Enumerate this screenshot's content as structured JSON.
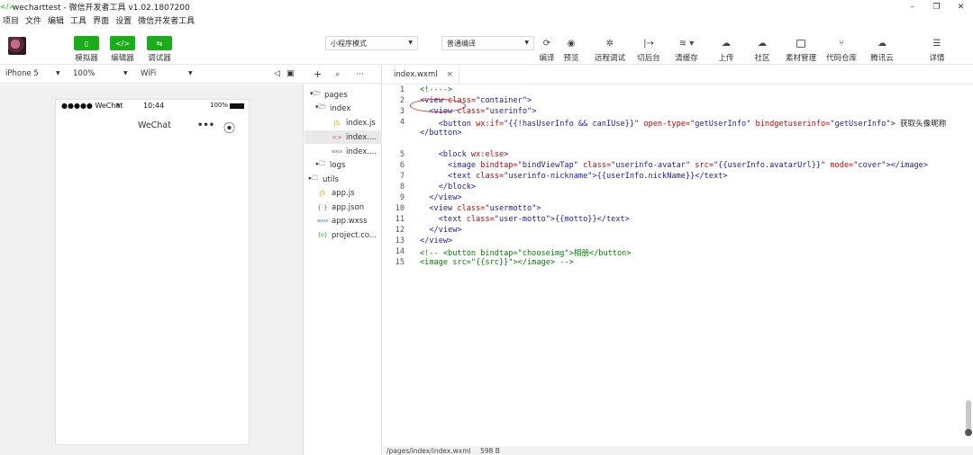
{
  "window": {
    "title": "wecharttest - 微信开发者工具 v1.02.1807200",
    "minimize": "–",
    "maximize": "❐",
    "close": "✕"
  },
  "menu": [
    "项目",
    "文件",
    "编辑",
    "工具",
    "界面",
    "设置",
    "微信开发者工具"
  ],
  "toolbar": {
    "simulator": "模拟器",
    "editor": "编辑器",
    "debugger": "调试器",
    "mode_select": "小程序模式",
    "compile_select": "普通编译",
    "tools": [
      "编译",
      "预览",
      "远程调试",
      "切后台",
      "清缓存",
      "上传",
      "社区",
      "素材管理",
      "代码仓库",
      "腾讯云",
      "详情"
    ]
  },
  "simbar": {
    "device": "iPhone 5",
    "zoom": "100%",
    "network": "WiFi"
  },
  "phone": {
    "carrier": "●●●●● WeChat",
    "time": "10:44",
    "battery": "100%",
    "nav_title": "WeChat",
    "more": "•••",
    "close": "⦿"
  },
  "files": {
    "pages": "pages",
    "index": "index",
    "index_js": "index.js",
    "index_wxml": "index....",
    "index_wxss": "index....",
    "logs": "logs",
    "utils": "utils",
    "app_js": "app.js",
    "app_json": "app.json",
    "app_wxss": "app.wxss",
    "project": "project.co..."
  },
  "editor": {
    "tab": "index.wxml",
    "tab_close": "×"
  },
  "code_lines": [
    "1",
    "2",
    "3",
    "4",
    "5",
    "6",
    "7",
    "8",
    "9",
    "10",
    "11",
    "12",
    "13",
    "14",
    "15"
  ],
  "code": {
    "l1": "<!---->",
    "l2a": "<view ",
    "l2b": "class=",
    "l2c": "\"container\"",
    "l2d": ">",
    "l3a": "  <view ",
    "l3b": "class=",
    "l3c": "\"userinfo\"",
    "l3d": ">",
    "l4a": "    <button ",
    "l4b": "wx:if=",
    "l4c": "\"{{!hasUserInfo && canIUse}}\"",
    "l4d": " open-type=",
    "l4e": "\"getUserInfo\"",
    "l4f": " bindgetuserinfo=",
    "l4g": "\"getUserInfo\"",
    "l4h": "> 获取头像昵称",
    "l4w": "</button>",
    "l5a": "    <block ",
    "l5b": "wx:else",
    "l5c": ">",
    "l6a": "      <image ",
    "l6b": "bindtap=",
    "l6c": "\"bindViewTap\"",
    "l6d": " class=",
    "l6e": "\"userinfo-avatar\"",
    "l6f": " src=",
    "l6g": "\"{{userInfo.avatarUrl}}\"",
    "l6h": " mode=",
    "l6i": "\"cover\"",
    "l6j": "></image>",
    "l7a": "      <text ",
    "l7b": "class=",
    "l7c": "\"userinfo-nickname\"",
    "l7d": ">{{userInfo.nickName}}</text>",
    "l8": "    </block>",
    "l9": "  </view>",
    "l10a": "  <view ",
    "l10b": "class=",
    "l10c": "\"usermotto\"",
    "l10d": ">",
    "l11a": "    <text ",
    "l11b": "class=",
    "l11c": "\"user-motto\"",
    "l11d": ">{{motto}}</text>",
    "l12": "  </view>",
    "l13": "</view>",
    "l14": "<!-- <button bindtap=\"chooseimg\">相册</button>",
    "l15": "<image src=\"{{src}}\"></image> -->"
  },
  "statusbar": {
    "path": "/pages/index/index.wxml",
    "size": "598 B"
  }
}
